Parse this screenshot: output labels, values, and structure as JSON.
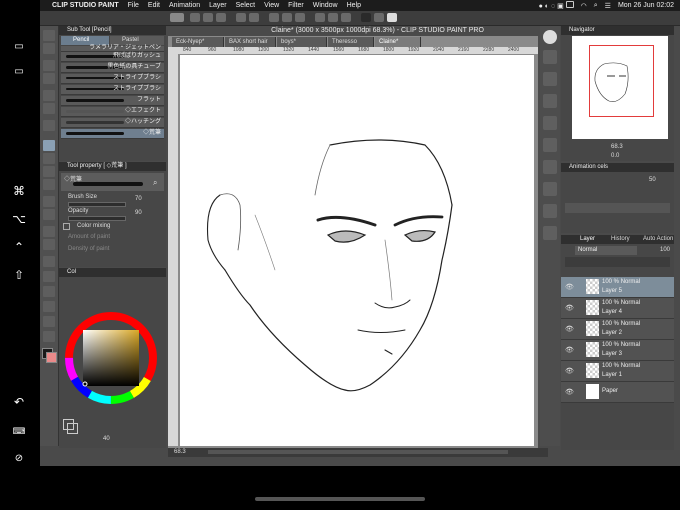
{
  "menubar": {
    "app_name": "CLIP STUDIO PAINT",
    "items": [
      "File",
      "Edit",
      "Animation",
      "Layer",
      "Select",
      "View",
      "Filter",
      "Window",
      "Help"
    ],
    "clock": "Mon 26 Jun  02:02"
  },
  "window": {
    "title": "Claine* (3000 x 3500px 1000dpi 68.3%) - CLIP STUDIO PAINT PRO"
  },
  "tabs": [
    {
      "label": "Eck-Nyep*"
    },
    {
      "label": "BAX short hair"
    },
    {
      "label": "boys*"
    },
    {
      "label": "Theresso con..."
    },
    {
      "label": "Claine*"
    }
  ],
  "ruler": {
    "ticks": [
      "840",
      "960",
      "1080",
      "1200",
      "1320",
      "1440",
      "1560",
      "1680",
      "1800",
      "1920",
      "2040",
      "2160",
      "2280",
      "2400"
    ]
  },
  "subtool": {
    "header": "Sub Tool [Pencil]",
    "tabs": [
      "Pencil",
      "Pastel"
    ],
    "brushes": [
      {
        "name": "ラメラリア・ジェットペン"
      },
      {
        "name": "飛ばばりガッシュ"
      },
      {
        "name": "黒色紙の具チューブ"
      },
      {
        "name": "ストライプブラシ"
      },
      {
        "name": "ストライプブラシ"
      },
      {
        "name": "フラット"
      },
      {
        "name": "◇エフェクト"
      },
      {
        "name": "◇ハッチング"
      },
      {
        "name": "◇荒筆"
      }
    ]
  },
  "toolprop": {
    "header": "Tool property [ ◇荒筆 ]",
    "preset": "◇荒筆",
    "brush_size_label": "Brush Size",
    "brush_size_value": "70",
    "opacity_label": "Opacity",
    "opacity_value": "90",
    "color_mixing_label": "Color mixing",
    "amount_label": "Amount of paint",
    "density_label": "Density of paint"
  },
  "color": {
    "tab_label": "Col",
    "size_value": "40",
    "main_color": "#1a1a1a",
    "sub_color": "#e98a8a"
  },
  "status": {
    "zoom": "68.3"
  },
  "navigator": {
    "title": "Navigator",
    "zoom": "68.3",
    "angle": "0.0"
  },
  "animation": {
    "title": "Animation cels",
    "value": "50"
  },
  "layers": {
    "tabs": [
      "Layer",
      "History",
      "Auto Action"
    ],
    "blend_mode": "Normal",
    "opacity": "100",
    "items": [
      {
        "opacity": "100 %",
        "mode": "Normal",
        "name": "Layer 5",
        "selected": true
      },
      {
        "opacity": "100 %",
        "mode": "Normal",
        "name": "Layer 4",
        "selected": false
      },
      {
        "opacity": "100 %",
        "mode": "Normal",
        "name": "Layer 2",
        "selected": false
      },
      {
        "opacity": "100 %",
        "mode": "Normal",
        "name": "Layer 3",
        "selected": false
      },
      {
        "opacity": "100 %",
        "mode": "Normal",
        "name": "Layer 1",
        "selected": false
      },
      {
        "opacity": "",
        "mode": "",
        "name": "Paper",
        "selected": false
      }
    ]
  }
}
